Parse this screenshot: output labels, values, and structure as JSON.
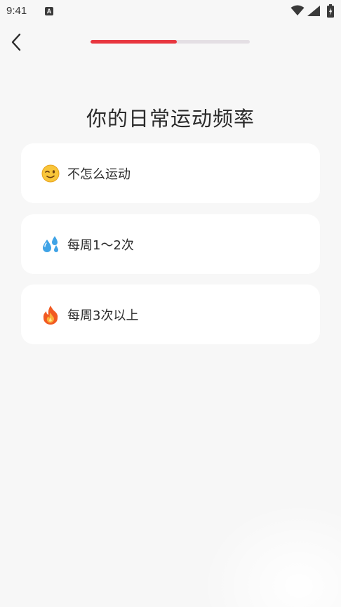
{
  "status_bar": {
    "time": "9:41",
    "notification_letter": "A"
  },
  "progress": {
    "fraction": 0.54,
    "fill_color": "#e8363f",
    "track_color": "#e4dfe4"
  },
  "title": "你的日常运动频率",
  "options": [
    {
      "label": "不怎么运动",
      "icon": "winking-face-icon"
    },
    {
      "label": "每周1～2次",
      "icon": "sweat-droplets-icon"
    },
    {
      "label": "每周3次以上",
      "icon": "fire-icon"
    }
  ]
}
